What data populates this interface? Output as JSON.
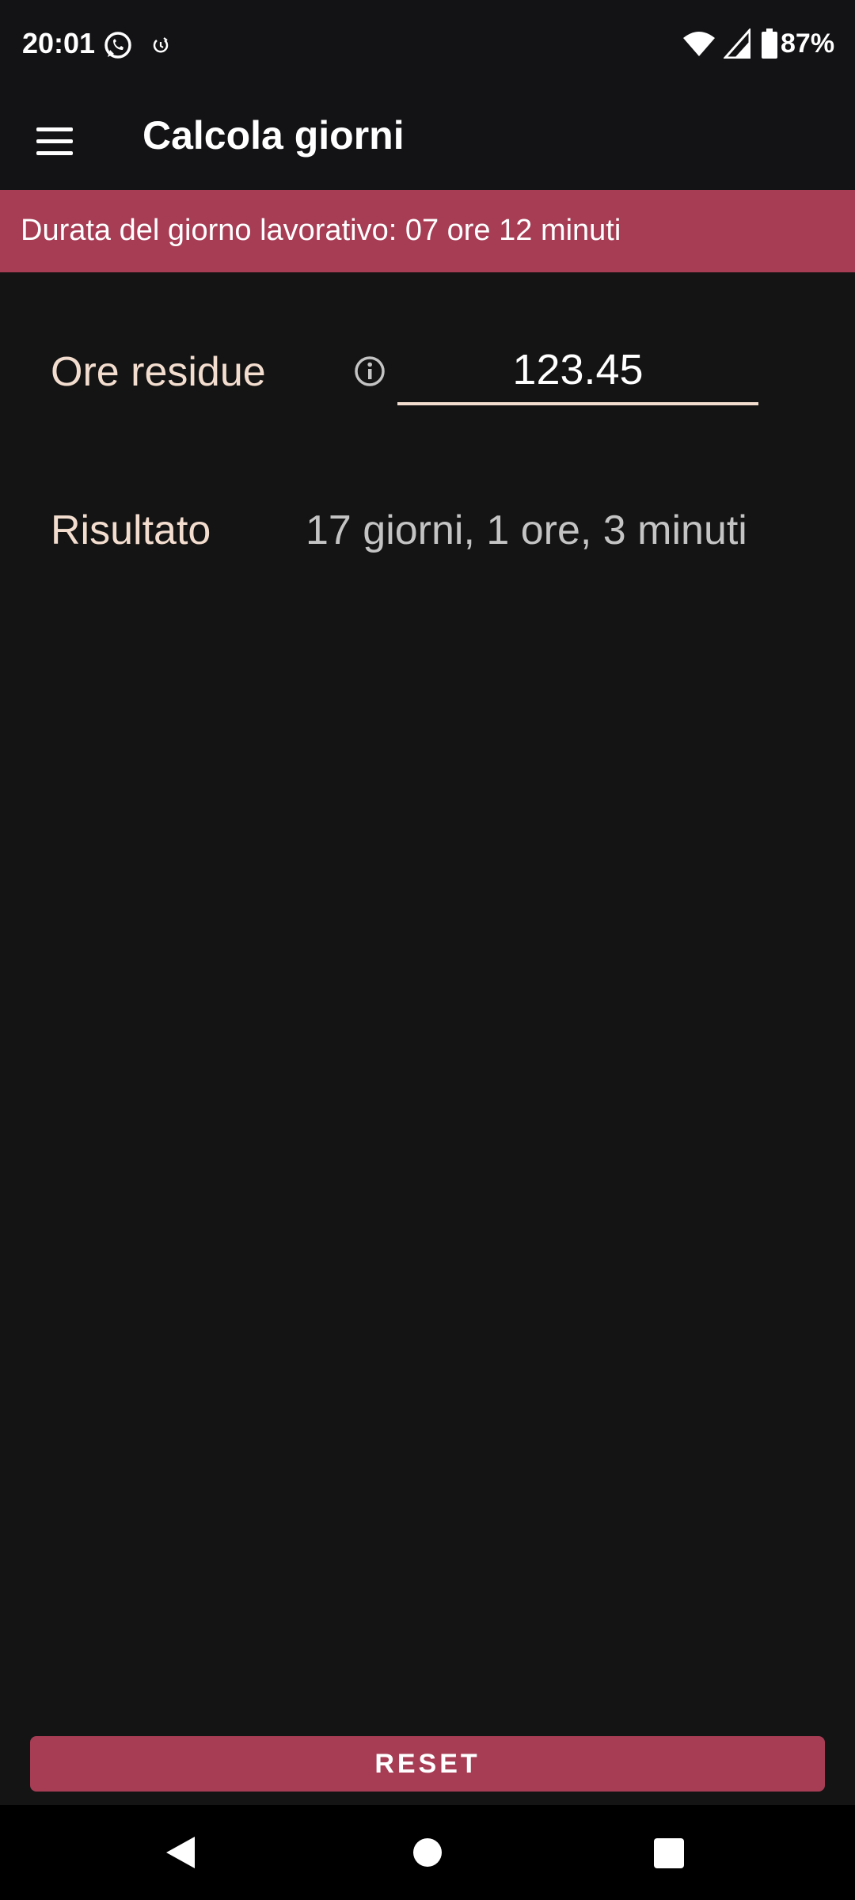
{
  "status_bar": {
    "time": "20:01",
    "battery_percent": "87%",
    "icons": [
      "whatsapp-icon",
      "alarm-icon",
      "wifi-icon",
      "signal-icon",
      "battery-icon"
    ]
  },
  "app_bar": {
    "title": "Calcola giorni",
    "menu_icon": "menu-icon"
  },
  "banner": {
    "text": "Durata del giorno lavorativo: 07 ore 12 minuti"
  },
  "form": {
    "hours_label": "Ore residue",
    "hours_value": "123.45",
    "info_icon": "info-icon",
    "result_label": "Risultato",
    "result_value": "17 giorni, 1 ore, 3 minuti"
  },
  "actions": {
    "reset_label": "RESET"
  },
  "nav_bar": {
    "icons": [
      "back-icon",
      "home-icon",
      "recents-icon"
    ]
  },
  "colors": {
    "accent": "#a73d55",
    "background": "#141414",
    "app_bar": "#131316",
    "label": "#f3ddcf",
    "result": "#c4c4c4"
  }
}
